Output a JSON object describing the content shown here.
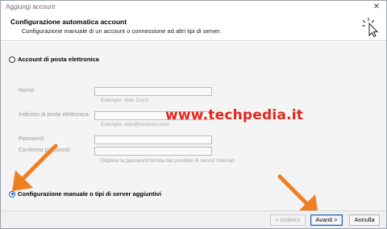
{
  "window": {
    "title": "Aggiungi account",
    "close_glyph": "✕"
  },
  "header": {
    "title": "Configurazione automatica account",
    "subtitle": "Configurazione manuale di un account o connessione ad altri tipi di server.",
    "icon": "cursor-click-icon"
  },
  "options": {
    "email_account_label": "Account di posta elettronica",
    "email_account_selected": false,
    "manual_label": "Configurazione manuale o tipi di server aggiuntivi",
    "manual_selected": true
  },
  "form": {
    "name_label": "Nome:",
    "name_hint": "Esempio: Aldo Cozzi",
    "email_label": "Indirizzo di posta elettronica:",
    "email_hint": "Esempio: aldo@contoso.com",
    "password_label": "Password:",
    "confirm_label": "Conferma password:",
    "password_hint": "Digitare la password fornita dal provider di servizi Internet."
  },
  "watermark": {
    "text": "www.techpedia.it"
  },
  "footer": {
    "back_label": "< Indietro",
    "next_label": "Avanti >",
    "cancel_label": "Annulla"
  },
  "colors": {
    "accent": "#1a5fb4",
    "arrow": "#f07f22",
    "watermark": "#e3261c"
  }
}
